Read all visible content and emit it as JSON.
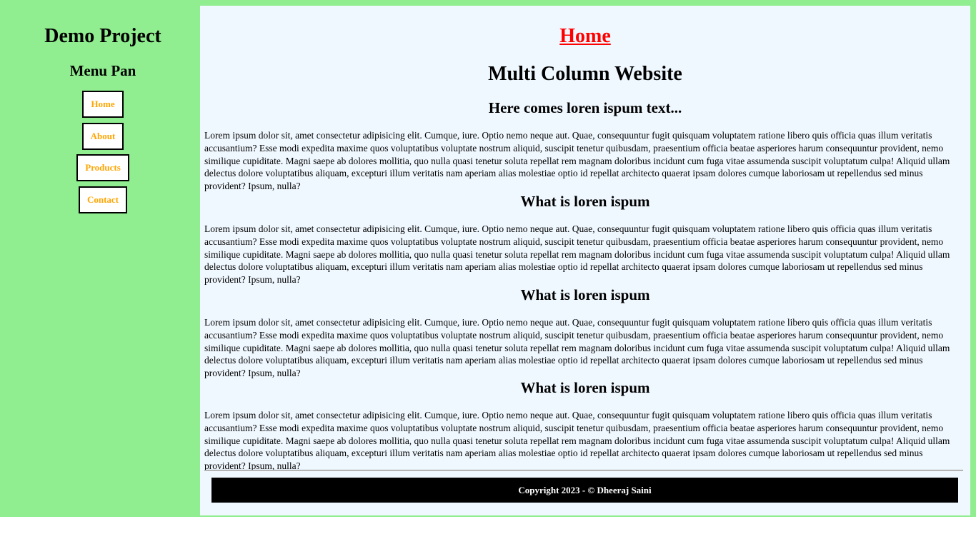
{
  "sidebar": {
    "site_title": "Demo Project",
    "menu_title": "Menu Pan",
    "items": [
      {
        "label": "Home"
      },
      {
        "label": "About"
      },
      {
        "label": "Products"
      },
      {
        "label": "Contact"
      }
    ]
  },
  "main": {
    "page_link": "Home",
    "title": "Multi Column Website",
    "sections": [
      {
        "heading": "Here comes loren ispum text...",
        "text": "Lorem ipsum dolor sit, amet consectetur adipisicing elit. Cumque, iure. Optio nemo neque aut. Quae, consequuntur fugit quisquam voluptatem ratione libero quis officia quas illum veritatis accusantium? Esse modi expedita maxime quos voluptatibus voluptate nostrum aliquid, suscipit tenetur quibusdam, praesentium officia beatae asperiores harum consequuntur provident, nemo similique cupiditate. Magni saepe ab dolores mollitia, quo nulla quasi tenetur soluta repellat rem magnam doloribus incidunt cum fuga vitae assumenda suscipit voluptatum culpa! Aliquid ullam delectus dolore voluptatibus aliquam, excepturi illum veritatis nam aperiam alias molestiae optio id repellat architecto quaerat ipsam dolores cumque laboriosam ut repellendus sed minus provident? Ipsum, nulla?"
      },
      {
        "heading": "What is loren ispum",
        "text": "Lorem ipsum dolor sit, amet consectetur adipisicing elit. Cumque, iure. Optio nemo neque aut. Quae, consequuntur fugit quisquam voluptatem ratione libero quis officia quas illum veritatis accusantium? Esse modi expedita maxime quos voluptatibus voluptate nostrum aliquid, suscipit tenetur quibusdam, praesentium officia beatae asperiores harum consequuntur provident, nemo similique cupiditate. Magni saepe ab dolores mollitia, quo nulla quasi tenetur soluta repellat rem magnam doloribus incidunt cum fuga vitae assumenda suscipit voluptatum culpa! Aliquid ullam delectus dolore voluptatibus aliquam, excepturi illum veritatis nam aperiam alias molestiae optio id repellat architecto quaerat ipsam dolores cumque laboriosam ut repellendus sed minus provident? Ipsum, nulla?"
      },
      {
        "heading": "What is loren ispum",
        "text": "Lorem ipsum dolor sit, amet consectetur adipisicing elit. Cumque, iure. Optio nemo neque aut. Quae, consequuntur fugit quisquam voluptatem ratione libero quis officia quas illum veritatis accusantium? Esse modi expedita maxime quos voluptatibus voluptate nostrum aliquid, suscipit tenetur quibusdam, praesentium officia beatae asperiores harum consequuntur provident, nemo similique cupiditate. Magni saepe ab dolores mollitia, quo nulla quasi tenetur soluta repellat rem magnam doloribus incidunt cum fuga vitae assumenda suscipit voluptatum culpa! Aliquid ullam delectus dolore voluptatibus aliquam, excepturi illum veritatis nam aperiam alias molestiae optio id repellat architecto quaerat ipsam dolores cumque laboriosam ut repellendus sed minus provident? Ipsum, nulla?"
      },
      {
        "heading": "What is loren ispum",
        "text": "Lorem ipsum dolor sit, amet consectetur adipisicing elit. Cumque, iure. Optio nemo neque aut. Quae, consequuntur fugit quisquam voluptatem ratione libero quis officia quas illum veritatis accusantium? Esse modi expedita maxime quos voluptatibus voluptate nostrum aliquid, suscipit tenetur quibusdam, praesentium officia beatae asperiores harum consequuntur provident, nemo similique cupiditate. Magni saepe ab dolores mollitia, quo nulla quasi tenetur soluta repellat rem magnam doloribus incidunt cum fuga vitae assumenda suscipit voluptatum culpa! Aliquid ullam delectus dolore voluptatibus aliquam, excepturi illum veritatis nam aperiam alias molestiae optio id repellat architecto quaerat ipsam dolores cumque laboriosam ut repellendus sed minus provident? Ipsum, nulla?"
      }
    ]
  },
  "footer": {
    "text": "Copyright 2023 - © Dheeraj Saini"
  },
  "colors": {
    "sidebar_bg": "#90ee90",
    "main_bg": "#f0f8ff",
    "nav_text": "#ffa500",
    "page_link": "#ff0000",
    "footer_bg": "#000000"
  }
}
